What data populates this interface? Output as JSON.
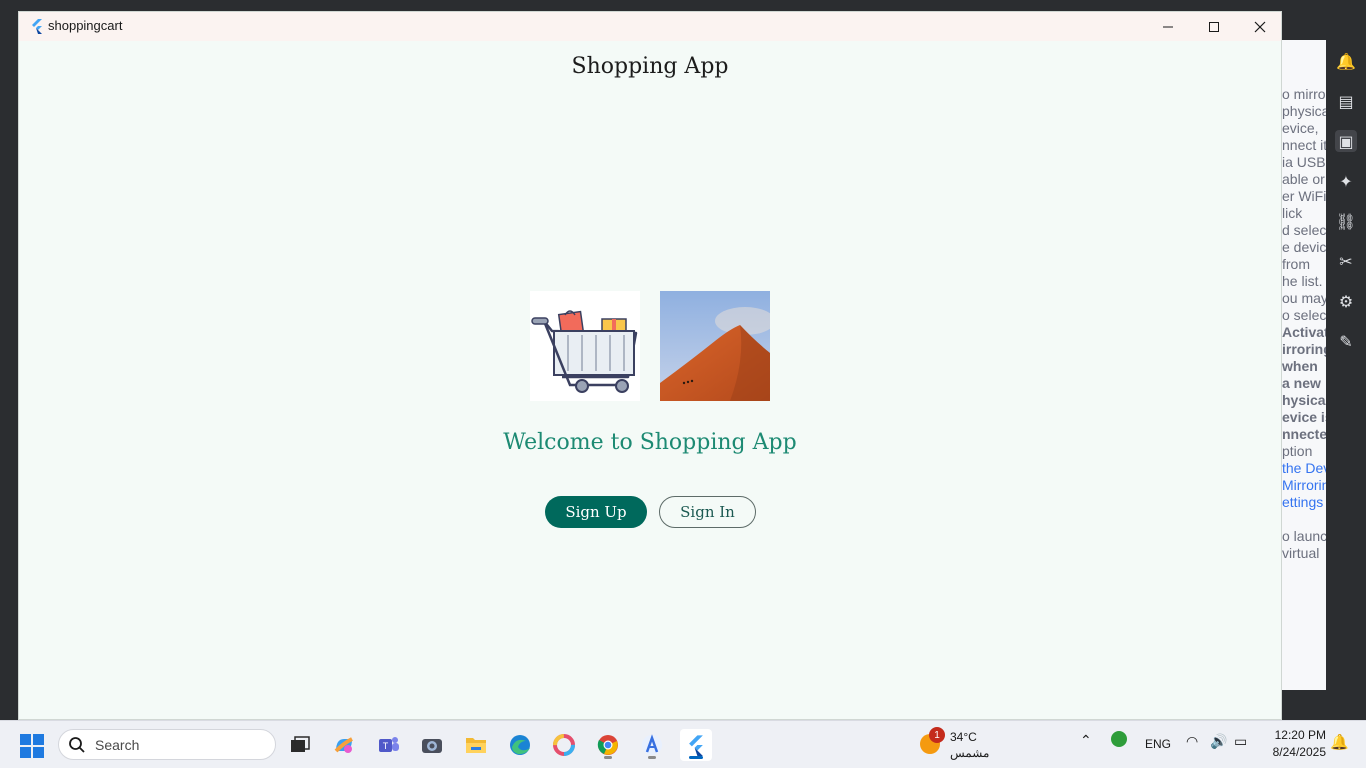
{
  "window": {
    "title": "shoppingcart",
    "minimize_glyph": "—",
    "maximize_glyph": "☐",
    "close_glyph": "✕"
  },
  "app": {
    "title": "Shopping App",
    "welcome": "Welcome to Shopping App",
    "signup_label": "Sign Up",
    "signin_label": "Sign In",
    "accent_color": "#00695c",
    "welcome_color": "#1d8a73"
  },
  "ide_panel": {
    "lines": [
      "o mirror",
      "physical",
      "evice,",
      "nnect it",
      "ia USB",
      "able or",
      "er WiFi.",
      "lick",
      "d select",
      "e device",
      "from",
      "he list.",
      "ou may",
      "o select",
      "Activate",
      "irroring",
      "when",
      "a new",
      "hysical",
      "evice is",
      "nnected",
      "ption",
      "the Dev",
      "Mirroring",
      "ettings"
    ],
    "extra_lines": [
      "o launch",
      "virtual"
    ]
  },
  "taskbar": {
    "search_placeholder": "Search",
    "weather_badge": "1",
    "weather_temp": "34°C",
    "weather_desc": "مشمس",
    "language": "ENG",
    "time": "12:20 PM",
    "date": "8/24/2025",
    "apps": [
      "task-view-icon",
      "copilot-icon",
      "teams-icon",
      "camera-icon",
      "file-explorer-icon",
      "edge-icon",
      "photos-icon",
      "chrome-icon",
      "android-studio-icon",
      "flutter-icon"
    ]
  }
}
